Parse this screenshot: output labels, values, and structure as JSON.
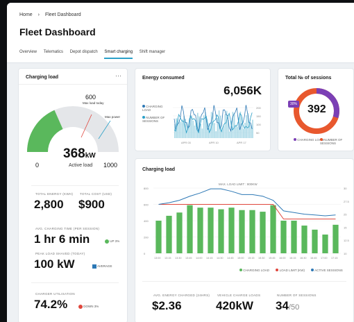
{
  "breadcrumb": {
    "home": "Home",
    "sep": "›",
    "current": "Fleet Dashboard"
  },
  "page_title": "Fleet Dashboard",
  "tabs": [
    {
      "label": "Overview"
    },
    {
      "label": "Telematics"
    },
    {
      "label": "Depot dispatch"
    },
    {
      "label": "Smart charging",
      "active": true
    },
    {
      "label": "Shift manager"
    }
  ],
  "charging_load": {
    "title": "Charging load",
    "menu": "···",
    "max_load_today_value": "600",
    "max_load_today_label": "Max load today",
    "max_power_label": "Max power",
    "active_load_value": "368",
    "active_load_unit": "kW",
    "active_load_label": "Active load",
    "scale_min": "0",
    "scale_max": "1000",
    "gauge_fraction": 0.368,
    "total_energy_label": "Total energy (kWh)",
    "total_energy_value": "2,800",
    "total_cost_label": "Total cost (USD)",
    "total_cost_value": "$900",
    "avg_time_label": "Avg. charging time (per session)",
    "avg_time_value": "1 hr 6 min",
    "avg_time_delta": "UP 3%",
    "peak_load_label": "Peak load shaved (today)",
    "peak_load_value": "100 kW",
    "peak_load_badge": "Average",
    "utilisation_label": "Charger utilisation",
    "utilisation_value": "74.2%",
    "utilisation_delta": "DOWN 3%"
  },
  "energy_consumed": {
    "title": "Energy consumed",
    "value": "6,056K",
    "legend": [
      "Charging load",
      "Number of sessions"
    ],
    "y_ticks": [
      "200",
      "150",
      "100",
      "50"
    ],
    "x_ticks": [
      "APR 03",
      "APR 10",
      "APR 17"
    ]
  },
  "sessions": {
    "title": "Total № of sessions",
    "value": "392",
    "percent": "30%",
    "fraction": 0.3,
    "legend": [
      "Charging load",
      "Number of sessions"
    ]
  },
  "charging_chart": {
    "title": "Charging load",
    "limit_label": "MAX. LOAD LIMIT : 800KW",
    "legend": [
      "Charging load",
      "Load limit (kW)",
      "Active sessions"
    ],
    "avg_energy_label": "Avg. energy charged (24hrs)",
    "avg_energy_value": "$2.36",
    "vehicle_load_label": "Vehicle charge loads",
    "vehicle_load_value": "420kW",
    "sessions_label": "Number of sessions",
    "sessions_value": "34",
    "sessions_total": "/50"
  },
  "chart_data": [
    {
      "type": "bar",
      "title": "Charging load",
      "categories": [
        "13:00",
        "13:15",
        "13:30",
        "13:45",
        "14:00",
        "14:15",
        "14:30",
        "14:45",
        "15:00",
        "15:15",
        "15:30",
        "15:45",
        "16:00",
        "16:15",
        "16:30",
        "16:45",
        "17:00",
        "17:15"
      ],
      "ylim": [
        0,
        800
      ],
      "y_ticks": [
        "800",
        "600",
        "400",
        "200",
        "0"
      ],
      "y2_ticks": [
        "30",
        "27.5",
        "25",
        "15",
        "12.5",
        "10"
      ],
      "series": [
        {
          "name": "Charging load",
          "values": [
            400,
            460,
            500,
            590,
            560,
            560,
            540,
            560,
            530,
            530,
            510,
            590,
            400,
            400,
            340,
            290,
            230,
            350
          ]
        },
        {
          "name": "Load limit (kW)",
          "values": [
            600,
            600,
            600,
            600,
            600,
            600,
            600,
            600,
            600,
            600,
            600,
            600,
            420,
            420,
            420,
            420,
            420,
            420
          ]
        },
        {
          "name": "Active sessions",
          "values": [
            600,
            620,
            650,
            700,
            740,
            790,
            790,
            760,
            720,
            720,
            700,
            650,
            520,
            500,
            480,
            470,
            460,
            470
          ]
        }
      ]
    }
  ],
  "colors": {
    "green": "#5ab85c",
    "red": "#e0463c",
    "blue": "#2d78b5",
    "teal": "#2aa0c8",
    "purple": "#7b3fb5",
    "orange": "#e8582e"
  }
}
